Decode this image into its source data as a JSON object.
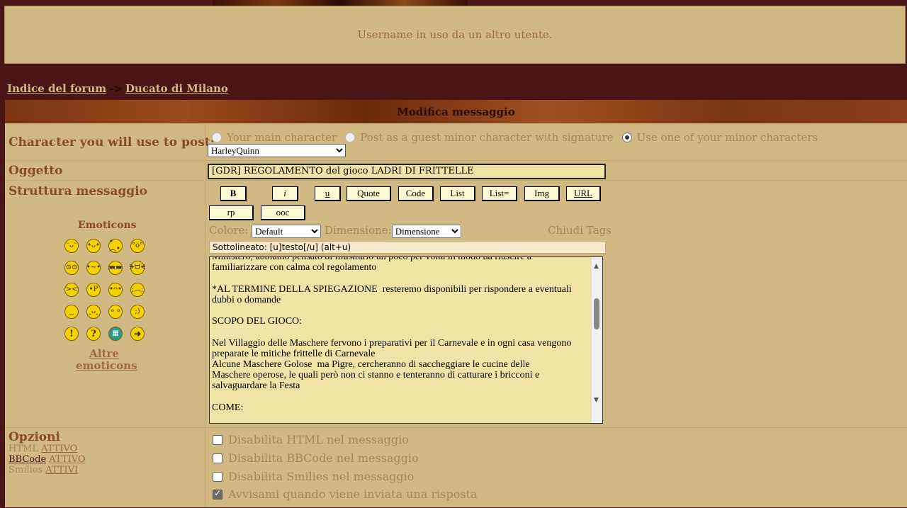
{
  "notice": {
    "text": "Username in uso da un altro utente."
  },
  "breadcrumb": {
    "home": "Indice del forum",
    "sep": "->",
    "current": "Ducato di Milano"
  },
  "header": {
    "title": "Modifica messaggio"
  },
  "character": {
    "label": "Character you will use to post:",
    "options": [
      "Your main character",
      "Post as a guest minor character with signature",
      "Use one of your minor characters"
    ],
    "selected_index": 2,
    "select_value": "HarleyQuinn"
  },
  "subject": {
    "label": "Oggetto",
    "value": "[GDR] REGOLAMENTO del gioco  LADRI DI FRITTELLE"
  },
  "structure": {
    "label": "Struttura messaggio"
  },
  "toolbar": {
    "b": "B",
    "i": "i",
    "u": "u",
    "quote": "Quote",
    "code": "Code",
    "list": "List",
    "listeq": "List=",
    "img": "Img",
    "url": "URL",
    "rp": "rp",
    "ooc": "ooc"
  },
  "emoticons": {
    "title": "Emoticons",
    "more": "Altre emoticons"
  },
  "format": {
    "color_label": "Colore:",
    "color_value": "Default",
    "size_label": "Dimensione:",
    "size_value": "Dimensione",
    "close_tags": "Chiudi Tags"
  },
  "helpline": "Sottolineato: [u]testo[/u]  (alt+u)",
  "message": "Ministero, abbiamo pensato di illustrarlo un poco per volta in modo da riuscire a\nfamiliarizzare con calma col regolamento\n\n*AL TERMINE DELLA SPIEGAZIONE  resteremo disponibili per rispondere a eventuali\ndubbi o domande\n\nSCOPO DEL GIOCO:\n\nNel Villaggio delle Maschere fervono i preparativi per il Carnevale e in ogni casa vengono\npreparate le mitiche frittelle di Carnevale\nAlcune Maschere Golose  ma Pigre, cercheranno di saccheggiare le cucine delle\nMaschere operose, le quali però non ci stanno e tenteranno di catturare i bricconi e\nsalvaguardare la Festa\n\nCOME:",
  "options": {
    "label": "Opzioni",
    "html": "HTML",
    "html_state": "ATTIVO",
    "bbcode": "BBCode",
    "bbcode_state": "ATTIVO",
    "smilies": "Smilies",
    "smilies_state": "ATTIVI",
    "checks": [
      "Disabilita HTML nel messaggio",
      "Disabilita BBCode nel messaggio",
      "Disabilita Smilies nel messaggio",
      "Avvisami quando viene inviata una risposta"
    ],
    "checked": [
      false,
      false,
      false,
      true
    ]
  }
}
